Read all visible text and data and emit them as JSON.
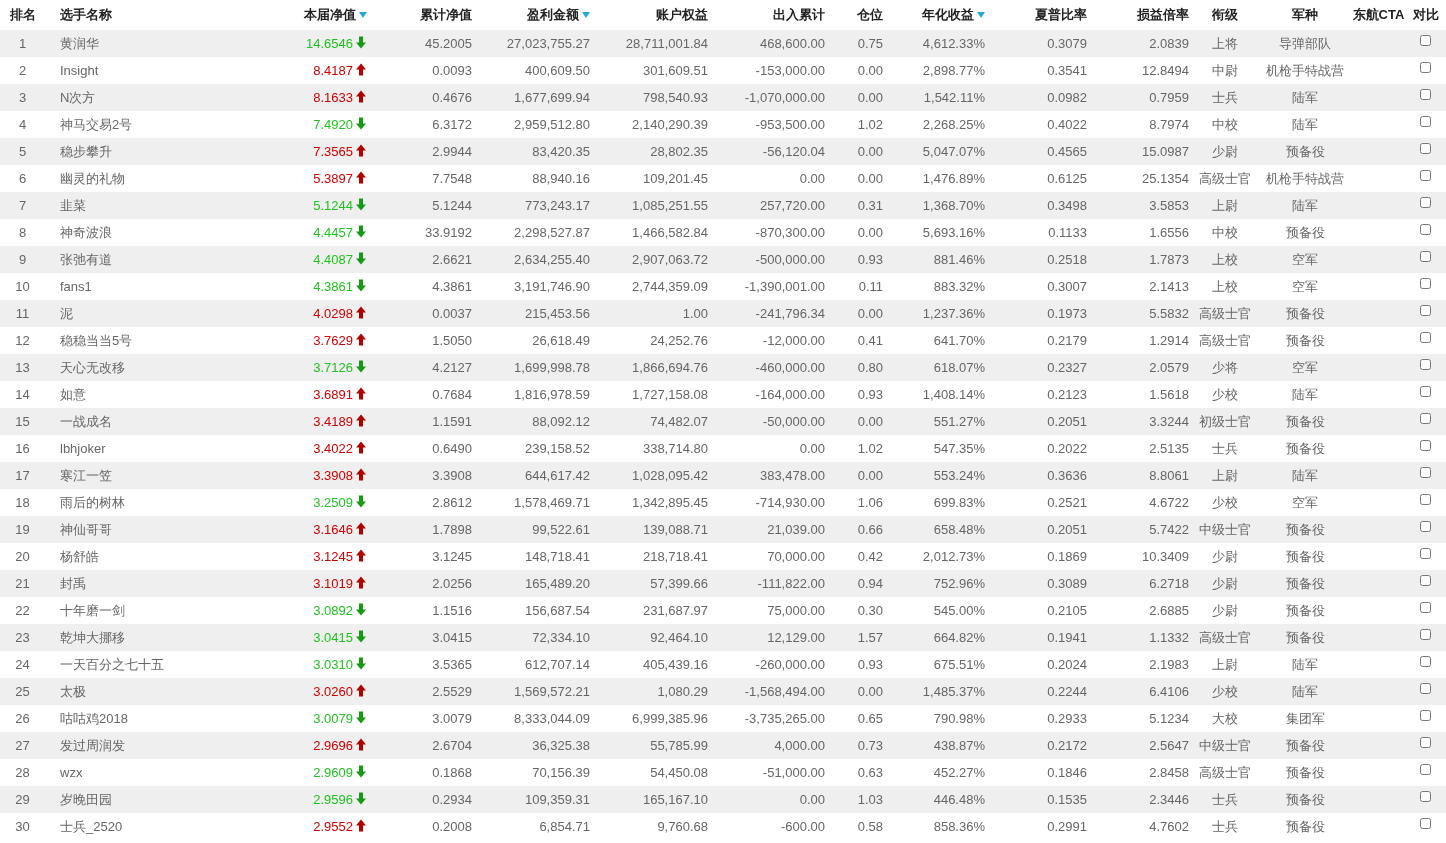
{
  "table": {
    "columns": [
      {
        "label": "排名",
        "sort_indicator": false
      },
      {
        "label": "选手名称",
        "sort_indicator": false
      },
      {
        "label": "本届净值",
        "sort_indicator": true
      },
      {
        "label": "累计净值",
        "sort_indicator": false
      },
      {
        "label": "盈利金额",
        "sort_indicator": true
      },
      {
        "label": "账户权益",
        "sort_indicator": false
      },
      {
        "label": "出入累计",
        "sort_indicator": false
      },
      {
        "label": "仓位",
        "sort_indicator": false
      },
      {
        "label": "年化收益",
        "sort_indicator": true
      },
      {
        "label": "夏普比率",
        "sort_indicator": false
      },
      {
        "label": "损益倍率",
        "sort_indicator": false
      },
      {
        "label": "衔级",
        "sort_indicator": false
      },
      {
        "label": "军种",
        "sort_indicator": false
      },
      {
        "label": "东航CTA",
        "sort_indicator": false
      },
      {
        "label": "对比",
        "sort_indicator": false
      }
    ],
    "rows": [
      {
        "rank": "1",
        "name": "黄润华",
        "nav": "14.6546",
        "rising": false,
        "values": [
          "45.2005",
          "27,023,755.27",
          "28,711,001.84",
          "468,600.00",
          "0.75",
          "4,612.33%",
          "0.3079",
          "2.0839",
          "上将",
          "导弹部队"
        ],
        "checked": false
      },
      {
        "rank": "2",
        "name": "Insight",
        "nav": "8.4187",
        "rising": true,
        "values": [
          "0.0093",
          "400,609.50",
          "301,609.51",
          "-153,000.00",
          "0.00",
          "2,898.77%",
          "0.3541",
          "12.8494",
          "中尉",
          "机枪手特战营"
        ],
        "checked": false
      },
      {
        "rank": "3",
        "name": "N次方",
        "nav": "8.1633",
        "rising": true,
        "values": [
          "0.4676",
          "1,677,699.94",
          "798,540.93",
          "-1,070,000.00",
          "0.00",
          "1,542.11%",
          "0.0982",
          "0.7959",
          "士兵",
          "陆军"
        ],
        "checked": false
      },
      {
        "rank": "4",
        "name": "神马交易2号",
        "nav": "7.4920",
        "rising": false,
        "values": [
          "6.3172",
          "2,959,512.80",
          "2,140,290.39",
          "-953,500.00",
          "1.02",
          "2,268.25%",
          "0.4022",
          "8.7974",
          "中校",
          "陆军"
        ],
        "checked": false
      },
      {
        "rank": "5",
        "name": "稳步攀升",
        "nav": "7.3565",
        "rising": true,
        "values": [
          "2.9944",
          "83,420.35",
          "28,802.35",
          "-56,120.04",
          "0.00",
          "5,047.07%",
          "0.4565",
          "15.0987",
          "少尉",
          "预备役"
        ],
        "checked": false
      },
      {
        "rank": "6",
        "name": "幽灵的礼物",
        "nav": "5.3897",
        "rising": true,
        "values": [
          "7.7548",
          "88,940.16",
          "109,201.45",
          "0.00",
          "0.00",
          "1,476.89%",
          "0.6125",
          "25.1354",
          "高级士官",
          "机枪手特战营"
        ],
        "checked": false
      },
      {
        "rank": "7",
        "name": "韭菜",
        "nav": "5.1244",
        "rising": false,
        "values": [
          "5.1244",
          "773,243.17",
          "1,085,251.55",
          "257,720.00",
          "0.31",
          "1,368.70%",
          "0.3498",
          "3.5853",
          "上尉",
          "陆军"
        ],
        "checked": false
      },
      {
        "rank": "8",
        "name": "神奇波浪",
        "nav": "4.4457",
        "rising": false,
        "values": [
          "33.9192",
          "2,298,527.87",
          "1,466,582.84",
          "-870,300.00",
          "0.00",
          "5,693.16%",
          "0.1133",
          "1.6556",
          "中校",
          "预备役"
        ],
        "checked": false
      },
      {
        "rank": "9",
        "name": "张弛有道",
        "nav": "4.4087",
        "rising": false,
        "values": [
          "2.6621",
          "2,634,255.40",
          "2,907,063.72",
          "-500,000.00",
          "0.93",
          "881.46%",
          "0.2518",
          "1.7873",
          "上校",
          "空军"
        ],
        "checked": false
      },
      {
        "rank": "10",
        "name": "fans1",
        "nav": "4.3861",
        "rising": false,
        "values": [
          "4.3861",
          "3,191,746.90",
          "2,744,359.09",
          "-1,390,001.00",
          "0.11",
          "883.32%",
          "0.3007",
          "2.1413",
          "上校",
          "空军"
        ],
        "checked": false
      },
      {
        "rank": "11",
        "name": "泥",
        "nav": "4.0298",
        "rising": true,
        "values": [
          "0.0037",
          "215,453.56",
          "1.00",
          "-241,796.34",
          "0.00",
          "1,237.36%",
          "0.1973",
          "5.5832",
          "高级士官",
          "预备役"
        ],
        "checked": false
      },
      {
        "rank": "12",
        "name": "稳稳当当5号",
        "nav": "3.7629",
        "rising": true,
        "values": [
          "1.5050",
          "26,618.49",
          "24,252.76",
          "-12,000.00",
          "0.41",
          "641.70%",
          "0.2179",
          "1.2914",
          "高级士官",
          "预备役"
        ],
        "checked": false
      },
      {
        "rank": "13",
        "name": "天心无改移",
        "nav": "3.7126",
        "rising": false,
        "values": [
          "4.2127",
          "1,699,998.78",
          "1,866,694.76",
          "-460,000.00",
          "0.80",
          "618.07%",
          "0.2327",
          "2.0579",
          "少将",
          "空军"
        ],
        "checked": false
      },
      {
        "rank": "14",
        "name": "如意",
        "nav": "3.6891",
        "rising": true,
        "values": [
          "0.7684",
          "1,816,978.59",
          "1,727,158.08",
          "-164,000.00",
          "0.93",
          "1,408.14%",
          "0.2123",
          "1.5618",
          "少校",
          "陆军"
        ],
        "checked": false
      },
      {
        "rank": "15",
        "name": "一战成名",
        "nav": "3.4189",
        "rising": true,
        "values": [
          "1.1591",
          "88,092.12",
          "74,482.07",
          "-50,000.00",
          "0.00",
          "551.27%",
          "0.2051",
          "3.3244",
          "初级士官",
          "预备役"
        ],
        "checked": false
      },
      {
        "rank": "16",
        "name": "lbhjoker",
        "nav": "3.4022",
        "rising": true,
        "values": [
          "0.6490",
          "239,158.52",
          "338,714.80",
          "0.00",
          "1.02",
          "547.35%",
          "0.2022",
          "2.5135",
          "士兵",
          "预备役"
        ],
        "checked": false
      },
      {
        "rank": "17",
        "name": "寒江一笠",
        "nav": "3.3908",
        "rising": true,
        "values": [
          "3.3908",
          "644,617.42",
          "1,028,095.42",
          "383,478.00",
          "0.00",
          "553.24%",
          "0.3636",
          "8.8061",
          "上尉",
          "陆军"
        ],
        "checked": false
      },
      {
        "rank": "18",
        "name": "雨后的树林",
        "nav": "3.2509",
        "rising": false,
        "values": [
          "2.8612",
          "1,578,469.71",
          "1,342,895.45",
          "-714,930.00",
          "1.06",
          "699.83%",
          "0.2521",
          "4.6722",
          "少校",
          "空军"
        ],
        "checked": false
      },
      {
        "rank": "19",
        "name": "神仙哥哥",
        "nav": "3.1646",
        "rising": true,
        "values": [
          "1.7898",
          "99,522.61",
          "139,088.71",
          "21,039.00",
          "0.66",
          "658.48%",
          "0.2051",
          "5.7422",
          "中级士官",
          "预备役"
        ],
        "checked": false
      },
      {
        "rank": "20",
        "name": "杨舒皓",
        "nav": "3.1245",
        "rising": true,
        "values": [
          "3.1245",
          "148,718.41",
          "218,718.41",
          "70,000.00",
          "0.42",
          "2,012.73%",
          "0.1869",
          "10.3409",
          "少尉",
          "预备役"
        ],
        "checked": false
      },
      {
        "rank": "21",
        "name": "封禹",
        "nav": "3.1019",
        "rising": true,
        "values": [
          "2.0256",
          "165,489.20",
          "57,399.66",
          "-111,822.00",
          "0.94",
          "752.96%",
          "0.3089",
          "6.2718",
          "少尉",
          "预备役"
        ],
        "checked": false
      },
      {
        "rank": "22",
        "name": "十年磨一剑",
        "nav": "3.0892",
        "rising": false,
        "values": [
          "1.1516",
          "156,687.54",
          "231,687.97",
          "75,000.00",
          "0.30",
          "545.00%",
          "0.2105",
          "2.6885",
          "少尉",
          "预备役"
        ],
        "checked": false
      },
      {
        "rank": "23",
        "name": "乾坤大挪移",
        "nav": "3.0415",
        "rising": false,
        "values": [
          "3.0415",
          "72,334.10",
          "92,464.10",
          "12,129.00",
          "1.57",
          "664.82%",
          "0.1941",
          "1.1332",
          "高级士官",
          "预备役"
        ],
        "checked": false
      },
      {
        "rank": "24",
        "name": "一天百分之七十五",
        "nav": "3.0310",
        "rising": false,
        "values": [
          "3.5365",
          "612,707.14",
          "405,439.16",
          "-260,000.00",
          "0.93",
          "675.51%",
          "0.2024",
          "2.1983",
          "上尉",
          "陆军"
        ],
        "checked": false
      },
      {
        "rank": "25",
        "name": "太极",
        "nav": "3.0260",
        "rising": true,
        "values": [
          "2.5529",
          "1,569,572.21",
          "1,080.29",
          "-1,568,494.00",
          "0.00",
          "1,485.37%",
          "0.2244",
          "6.4106",
          "少校",
          "陆军"
        ],
        "checked": false
      },
      {
        "rank": "26",
        "name": "咕咕鸡2018",
        "nav": "3.0079",
        "rising": false,
        "values": [
          "3.0079",
          "8,333,044.09",
          "6,999,385.96",
          "-3,735,265.00",
          "0.65",
          "790.98%",
          "0.2933",
          "5.1234",
          "大校",
          "集团军"
        ],
        "checked": false
      },
      {
        "rank": "27",
        "name": "发过周润发",
        "nav": "2.9696",
        "rising": true,
        "values": [
          "2.6704",
          "36,325.38",
          "55,785.99",
          "4,000.00",
          "0.73",
          "438.87%",
          "0.2172",
          "2.5647",
          "中级士官",
          "预备役"
        ],
        "checked": false
      },
      {
        "rank": "28",
        "name": "wzx",
        "nav": "2.9609",
        "rising": false,
        "values": [
          "0.1868",
          "70,156.39",
          "54,450.08",
          "-51,000.00",
          "0.63",
          "452.27%",
          "0.1846",
          "2.8458",
          "高级士官",
          "预备役"
        ],
        "checked": false
      },
      {
        "rank": "29",
        "name": "岁晚田园",
        "nav": "2.9596",
        "rising": false,
        "values": [
          "0.2934",
          "109,359.31",
          "165,167.10",
          "0.00",
          "1.03",
          "446.48%",
          "0.1535",
          "2.3446",
          "士兵",
          "预备役"
        ],
        "checked": false
      },
      {
        "rank": "30",
        "name": "士兵_2520",
        "nav": "2.9552",
        "rising": true,
        "values": [
          "0.2008",
          "6,854.71",
          "9,760.68",
          "-600.00",
          "0.58",
          "858.36%",
          "0.2991",
          "4.7602",
          "士兵",
          "预备役"
        ],
        "checked": false
      }
    ]
  }
}
